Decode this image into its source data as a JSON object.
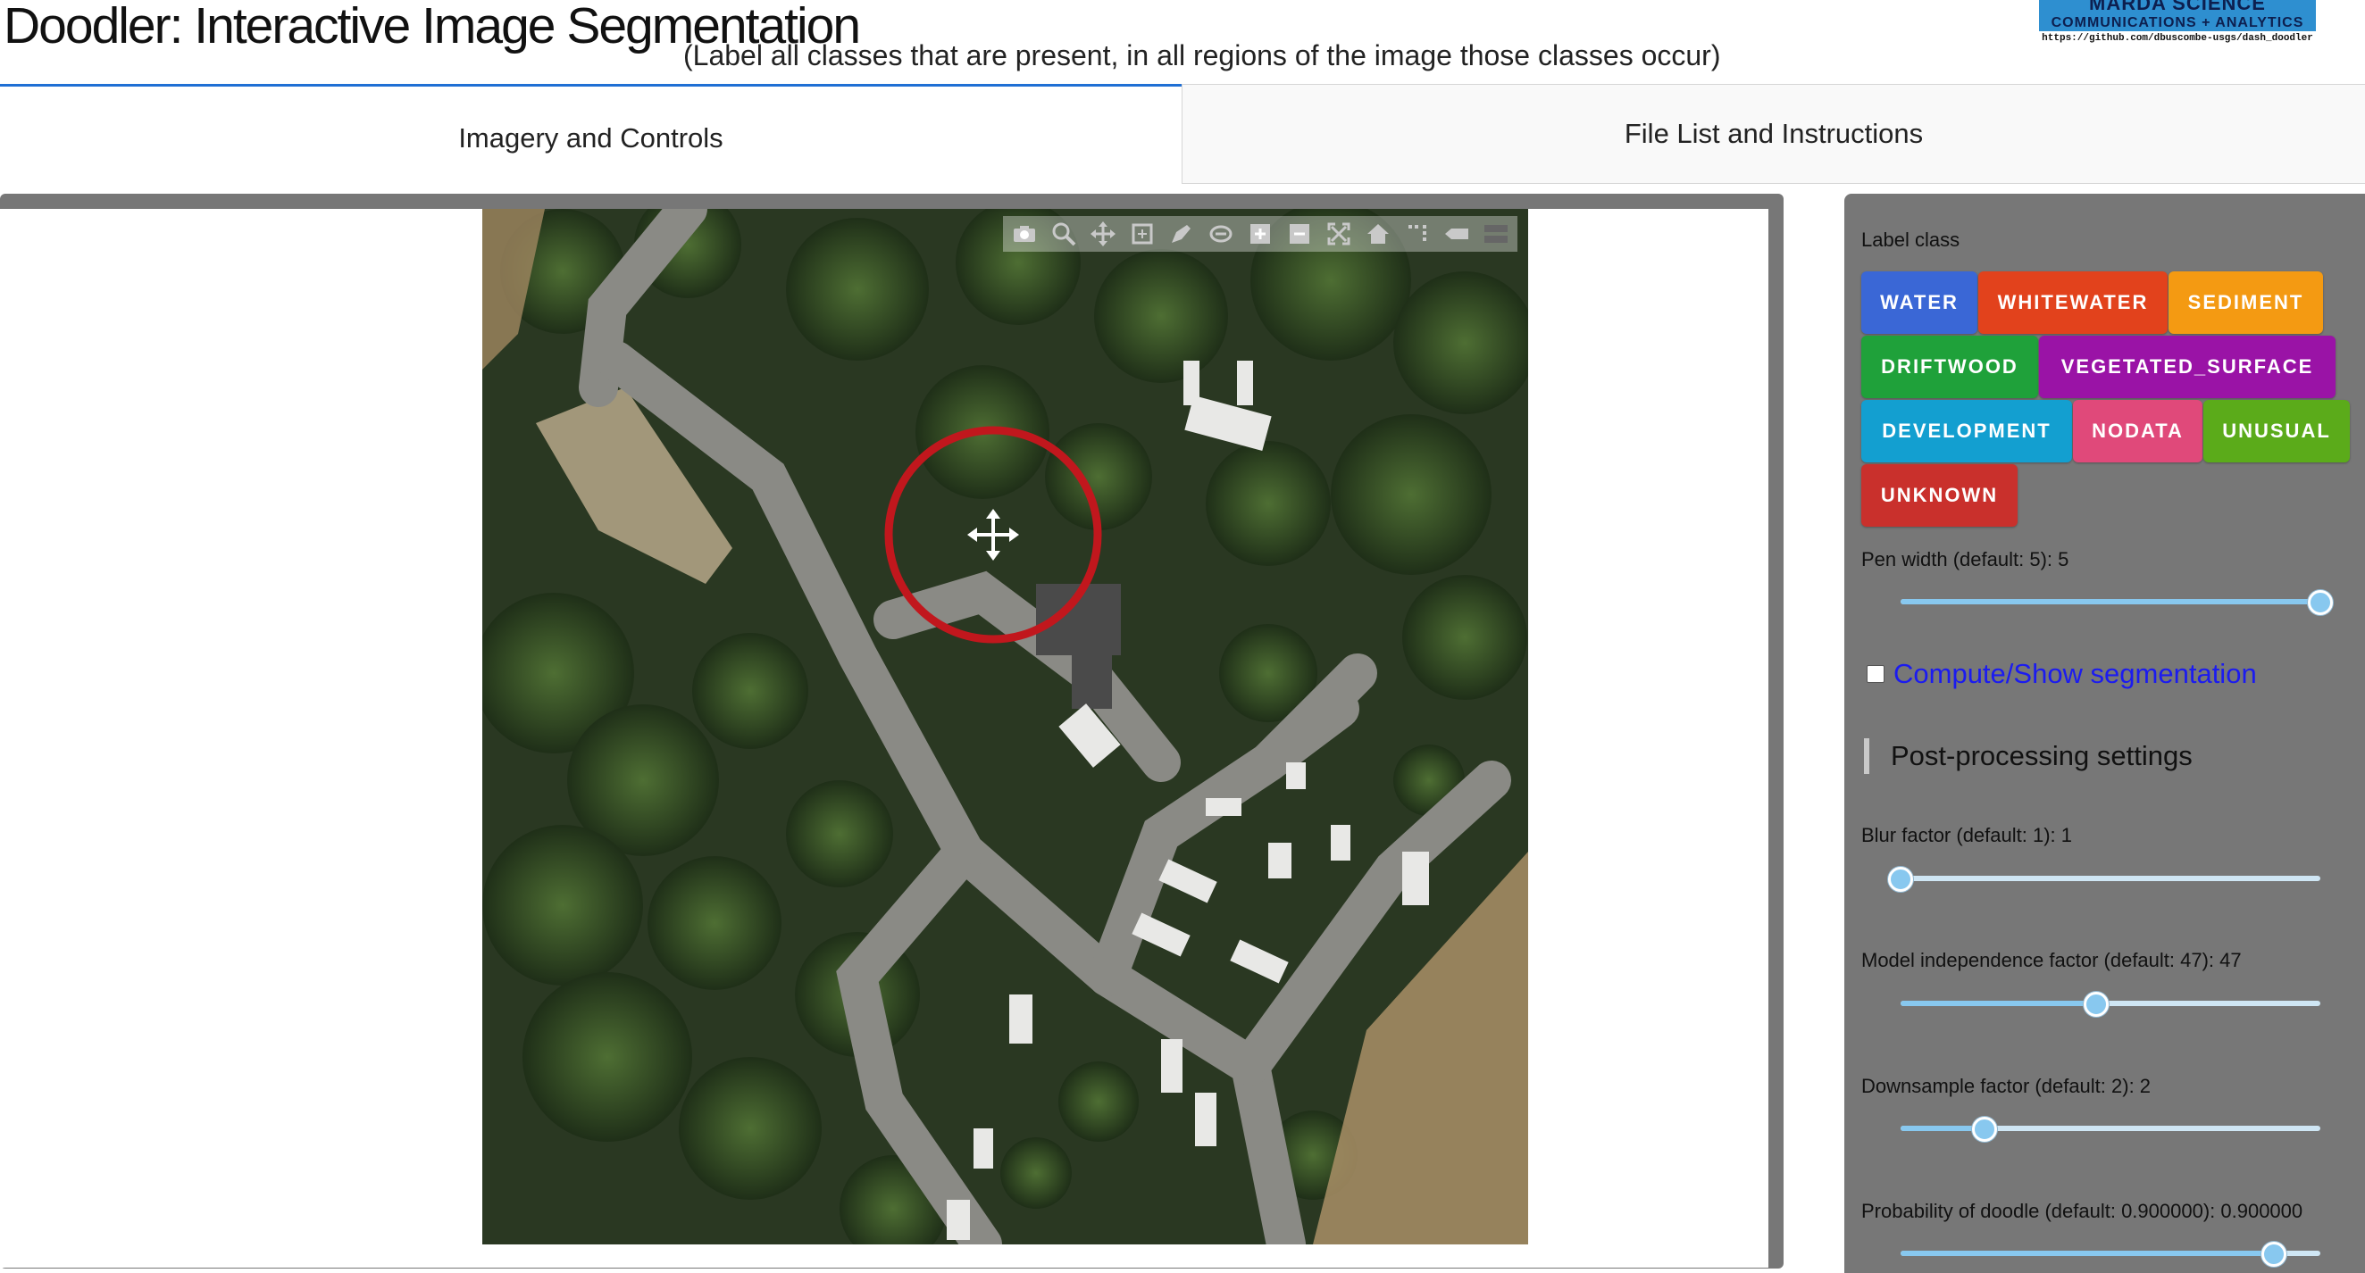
{
  "app": {
    "title": "Doodler: Interactive Image Segmentation",
    "subtitle": "(Label all classes that are present, in all regions of the image those classes occur)"
  },
  "logo": {
    "line1": "MARDA SCIENCE",
    "line2": "COMMUNICATIONS + ANALYTICS",
    "url": "https://github.com/dbuscombe-usgs/dash_doodler"
  },
  "tabs": [
    {
      "label": "Imagery and Controls",
      "active": true
    },
    {
      "label": "File List and Instructions",
      "active": false
    }
  ],
  "modebar": {
    "icons": [
      "camera-icon",
      "zoom-icon",
      "pan-icon",
      "zoom-box-icon",
      "draw-freehand-icon",
      "erase-shape-icon",
      "zoom-in-icon",
      "zoom-out-icon",
      "autoscale-icon",
      "home-icon",
      "spike-lines-icon",
      "hover-closest-icon",
      "hover-compare-icon"
    ]
  },
  "panel": {
    "label_class_title": "Label class",
    "classes": [
      {
        "name": "WATER",
        "color": "#3a67d6"
      },
      {
        "name": "WHITEWATER",
        "color": "#e2421c"
      },
      {
        "name": "SEDIMENT",
        "color": "#f49a12"
      },
      {
        "name": "DRIFTWOOD",
        "color": "#1fa13a"
      },
      {
        "name": "VEGETATED_SURFACE",
        "color": "#9a13a6"
      },
      {
        "name": "DEVELOPMENT",
        "color": "#139fd0"
      },
      {
        "name": "NODATA",
        "color": "#e0497a"
      },
      {
        "name": "UNUSUAL",
        "color": "#5bab1a"
      },
      {
        "name": "UNKNOWN",
        "color": "#c9302c"
      }
    ],
    "pen_width": {
      "label": "Pen width (default: 5): 5",
      "fraction": 1.0
    },
    "compute_label": "Compute/Show segmentation",
    "compute_checked": false,
    "post_title": "Post-processing settings",
    "blur": {
      "label": "Blur factor (default: 1): 1",
      "fraction": 0.0
    },
    "model_independence": {
      "label": "Model independence factor (default: 47): 47",
      "fraction": 0.465
    },
    "downsample": {
      "label": "Downsample factor (default: 2): 2",
      "fraction": 0.2
    },
    "probability": {
      "label": "Probability of doodle (default: 0.900000): 0.900000",
      "fraction": 0.89
    }
  }
}
